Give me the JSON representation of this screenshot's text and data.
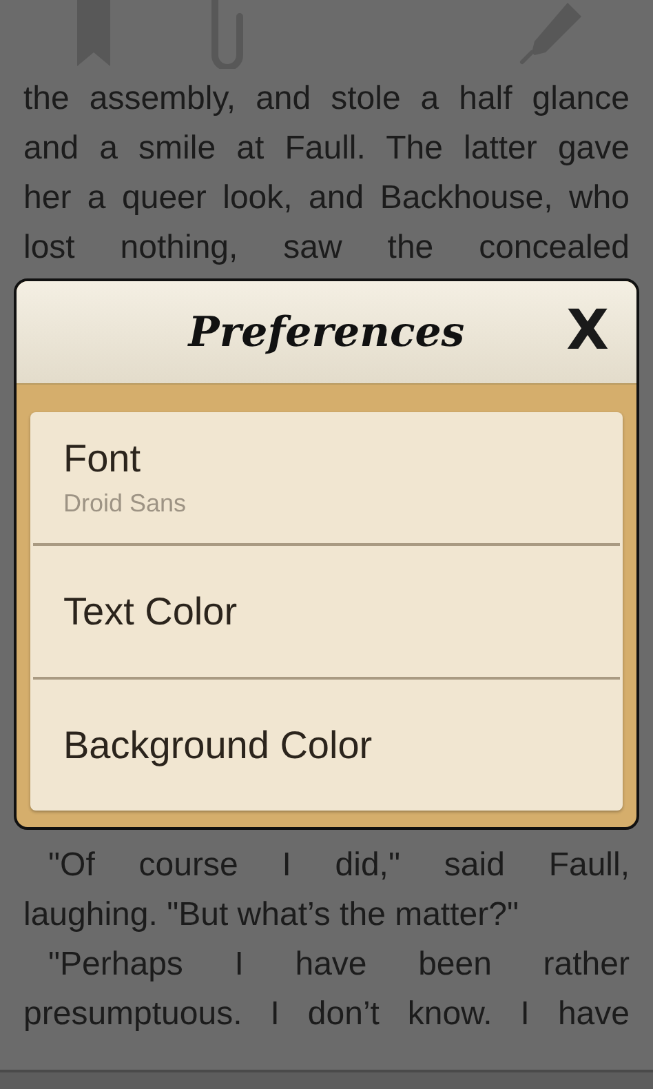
{
  "page_text_top": [
    {
      "text": "the assembly, and stole a half glance",
      "justified": true,
      "indented": false
    },
    {
      "text": "and a smile at Faull. The latter gave",
      "justified": true,
      "indented": false
    },
    {
      "text": "her a queer look, and Backhouse, who",
      "justified": true,
      "indented": false
    },
    {
      "text": "lost nothing, saw the concealed",
      "justified": true,
      "indented": false
    }
  ],
  "dialog": {
    "title": "Preferences",
    "close": "X",
    "items": [
      {
        "label": "Font",
        "summary": "Droid Sans"
      },
      {
        "label": "Text Color"
      },
      {
        "label": "Background Color"
      }
    ]
  },
  "page_text_bottom": [
    {
      "text": "\"Of course I did,\" said Faull,",
      "justified": true,
      "indented": true
    },
    {
      "text": "laughing. \"But what’s the matter?\"",
      "justified": false,
      "indented": false
    },
    {
      "text": "\"Perhaps I have been rather",
      "justified": true,
      "indented": true
    },
    {
      "text": "presumptuous. I don’t know. I have",
      "justified": true,
      "indented": false
    }
  ]
}
